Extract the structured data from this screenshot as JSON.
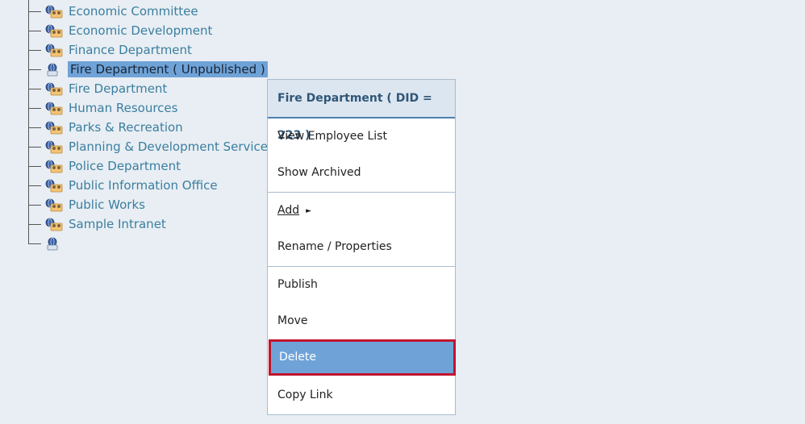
{
  "tree": {
    "items": [
      {
        "label": "Economic Committee",
        "icon": "group-folder-icon"
      },
      {
        "label": "Economic Development",
        "icon": "group-folder-icon"
      },
      {
        "label": "Finance Department",
        "icon": "group-folder-icon"
      },
      {
        "label": "Fire Department ( Unpublished )",
        "icon": "single-folder-icon",
        "selected": true
      },
      {
        "label": "Fire Department",
        "icon": "group-folder-icon"
      },
      {
        "label": "Human Resources",
        "icon": "group-folder-icon"
      },
      {
        "label": "Parks & Recreation",
        "icon": "group-folder-icon"
      },
      {
        "label": "Planning & Development Services",
        "icon": "group-folder-icon"
      },
      {
        "label": "Police Department",
        "icon": "group-folder-icon"
      },
      {
        "label": "Public Information Office",
        "icon": "group-folder-icon"
      },
      {
        "label": "Public Works",
        "icon": "group-folder-icon"
      },
      {
        "label": "Sample Intranet",
        "icon": "group-folder-icon"
      },
      {
        "label": "",
        "icon": "single-folder-icon"
      }
    ]
  },
  "context_menu": {
    "title": "Fire Department ( DID = 223 )",
    "view_employee_list": "View Employee List",
    "show_archived": "Show Archived",
    "add": "Add",
    "add_arrow": "►",
    "rename_properties": "Rename / Properties",
    "publish": "Publish",
    "move": "Move",
    "delete": "Delete",
    "copy_link": "Copy Link"
  },
  "colors": {
    "background": "#e8eef3",
    "link": "#3b7ea0",
    "selection": "#6fa3d8",
    "highlight_border": "#c0142e"
  }
}
